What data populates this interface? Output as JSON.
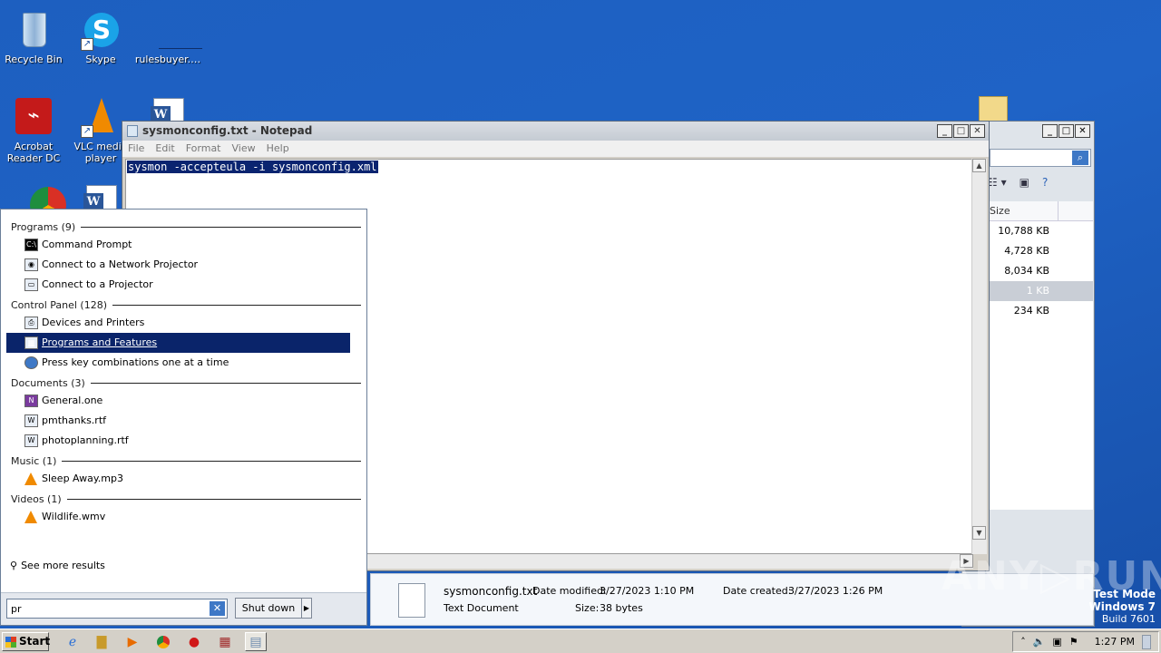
{
  "desktop": {
    "icons": [
      {
        "label": "Recycle Bin"
      },
      {
        "label": "Skype"
      },
      {
        "label": "rulesbuyer.…"
      },
      {
        "label": "Acrobat Reader DC"
      },
      {
        "label": "VLC media player"
      }
    ]
  },
  "notepad": {
    "title": "sysmonconfig.txt - Notepad",
    "menu": [
      "File",
      "Edit",
      "Format",
      "View",
      "Help"
    ],
    "content": "sysmon -accepteula -i sysmonconfig.xml"
  },
  "explorer": {
    "column_size": "Size",
    "rows": [
      "10,788 KB",
      "4,728 KB",
      "8,034 KB",
      "1 KB",
      "234 KB"
    ]
  },
  "details": {
    "filename": "sysmonconfig.txt",
    "type": "Text Document",
    "date_modified_label": "Date modified:",
    "date_modified": "3/27/2023 1:10 PM",
    "size_label": "Size:",
    "size": "38 bytes",
    "date_created_label": "Date created:",
    "date_created": "3/27/2023 1:26 PM"
  },
  "start_menu": {
    "categories": [
      {
        "label": "Programs (9)",
        "items": [
          "Command Prompt",
          "Connect to a Network Projector",
          "Connect to a Projector"
        ]
      },
      {
        "label": "Control Panel (128)",
        "items": [
          "Devices and Printers",
          "Programs and Features",
          "Press key combinations one at a time"
        ]
      },
      {
        "label": "Documents (3)",
        "items": [
          "General.one",
          "pmthanks.rtf",
          "photoplanning.rtf"
        ]
      },
      {
        "label": "Music (1)",
        "items": [
          "Sleep Away.mp3"
        ]
      },
      {
        "label": "Videos (1)",
        "items": [
          "Wildlife.wmv"
        ]
      }
    ],
    "see_more": "See more results",
    "search_value": "pr",
    "shutdown_label": "Shut down"
  },
  "taskbar": {
    "start_label": "Start",
    "clock": "1:27 PM"
  },
  "watermark": {
    "text": "ANY▷RUN",
    "test_mode": "Test Mode",
    "os": "Windows 7",
    "build": "Build 7601"
  }
}
